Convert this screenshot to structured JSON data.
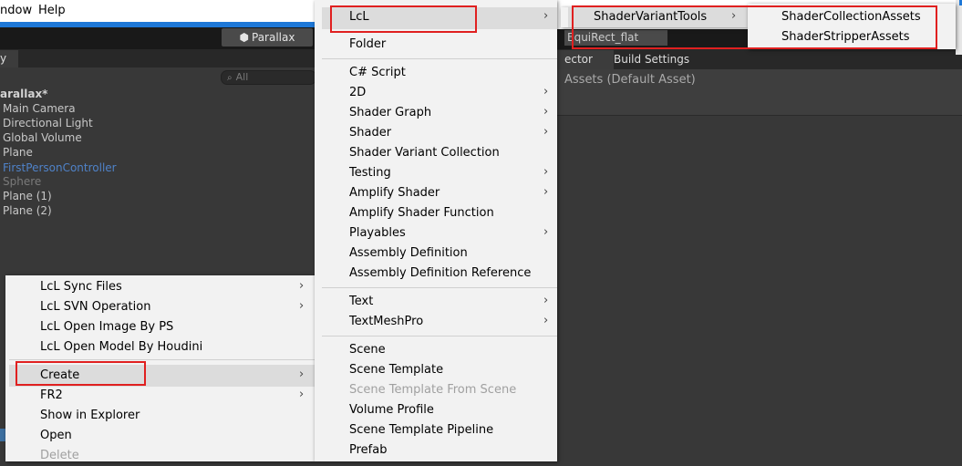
{
  "menubar": {
    "items": [
      "ndow",
      "Help"
    ]
  },
  "toolbar": {
    "scene_button": "Parallax"
  },
  "hierarchy": {
    "tab_label": "y",
    "search_placeholder": "All",
    "items": [
      {
        "label": "arallax*",
        "kind": "scene"
      },
      {
        "label": "Main Camera",
        "kind": "normal"
      },
      {
        "label": "Directional Light",
        "kind": "normal"
      },
      {
        "label": "Global Volume",
        "kind": "normal"
      },
      {
        "label": "Plane",
        "kind": "normal"
      },
      {
        "label": "FirstPersonController",
        "kind": "prefab"
      },
      {
        "label": "Sphere",
        "kind": "disabled"
      },
      {
        "label": "Plane (1)",
        "kind": "normal"
      },
      {
        "label": "Plane (2)",
        "kind": "normal"
      }
    ]
  },
  "context_menu": {
    "items": [
      {
        "label": "LcL Sync Files",
        "submenu": true
      },
      {
        "label": "LcL SVN Operation",
        "submenu": true
      },
      {
        "label": "LcL Open Image By PS",
        "submenu": false
      },
      {
        "label": "LcL Open Model By Houdini",
        "submenu": false
      },
      {
        "label": "Create",
        "submenu": true,
        "highlighted": true
      },
      {
        "label": "FR2",
        "submenu": true
      },
      {
        "label": "Show in Explorer",
        "submenu": false
      },
      {
        "label": "Open",
        "submenu": false
      },
      {
        "label": "Delete",
        "submenu": false,
        "disabled": true
      }
    ]
  },
  "create_menu": {
    "items": [
      {
        "label": "LcL",
        "submenu": true,
        "highlighted": true
      },
      {
        "label": "Folder"
      },
      {
        "label": "C# Script"
      },
      {
        "label": "2D",
        "submenu": true
      },
      {
        "label": "Shader Graph",
        "submenu": true
      },
      {
        "label": "Shader",
        "submenu": true
      },
      {
        "label": "Shader Variant Collection"
      },
      {
        "label": "Testing",
        "submenu": true
      },
      {
        "label": "Amplify Shader",
        "submenu": true
      },
      {
        "label": "Amplify Shader Function"
      },
      {
        "label": "Playables",
        "submenu": true
      },
      {
        "label": "Assembly Definition"
      },
      {
        "label": "Assembly Definition Reference"
      },
      {
        "label": "Text",
        "submenu": true
      },
      {
        "label": "TextMeshPro",
        "submenu": true
      },
      {
        "label": "Scene"
      },
      {
        "label": "Scene Template"
      },
      {
        "label": "Scene Template From Scene",
        "disabled": true
      },
      {
        "label": "Volume Profile"
      },
      {
        "label": "Scene Template Pipeline"
      },
      {
        "label": "Prefab"
      }
    ]
  },
  "lcl_menu": {
    "items": [
      {
        "label": "ShaderVariantTools",
        "submenu": true,
        "highlighted": true
      }
    ]
  },
  "shader_variant_menu": {
    "items": [
      {
        "label": "ShaderCollectionAssets"
      },
      {
        "label": "ShaderStripperAssets"
      }
    ]
  },
  "right_panel": {
    "equirect": "EquiRect_flat",
    "tabs": [
      "ector",
      "Build Settings"
    ],
    "title": "Assets (Default Asset)"
  },
  "colors": {
    "highlight_box": "#e02020",
    "prefab_blue": "#4f82c8",
    "accent_blue": "#1e78d7"
  },
  "icons": {
    "submenu_arrow": "chevron-right-icon",
    "scene_cube": "unity-cube-icon",
    "search": "search-icon"
  }
}
